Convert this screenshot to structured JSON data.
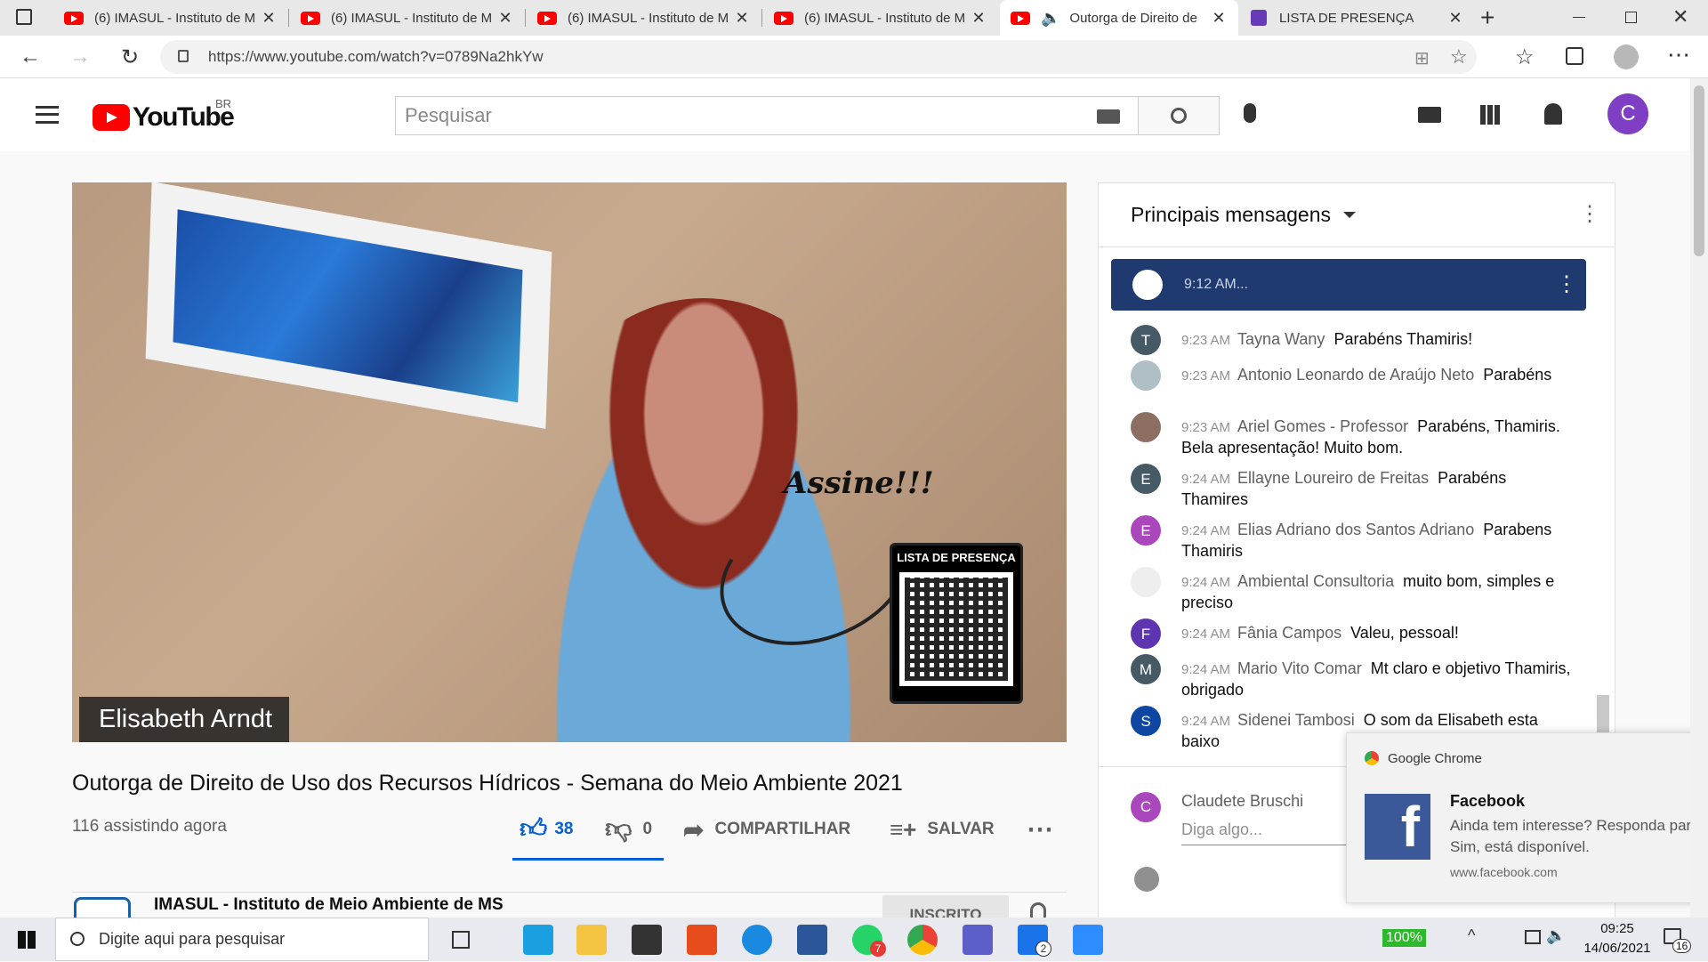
{
  "browser": {
    "tabs": [
      {
        "title": "(6) IMASUL - Instituto de M"
      },
      {
        "title": "(6) IMASUL - Instituto de M"
      },
      {
        "title": "(6) IMASUL - Instituto de M"
      },
      {
        "title": "(6) IMASUL - Instituto de M"
      },
      {
        "title": "Outorga de Direito de"
      },
      {
        "title": "LISTA DE PRESENÇA"
      }
    ],
    "url": "https://www.youtube.com/watch?v=0789Na2hkYw"
  },
  "youtube": {
    "logo": "YouTube",
    "region": "BR",
    "search_placeholder": "Pesquisar",
    "avatar_letter": "C"
  },
  "video": {
    "speaker_name": "Elisabeth Arndt",
    "overlay_text": "Assine!!!",
    "qr_label": "LISTA DE PRESENÇA",
    "title": "Outorga de Direito de Uso dos Recursos Hídricos - Semana do Meio Ambiente 2021",
    "viewers": "116 assistindo agora",
    "likes": "38",
    "dislikes": "0",
    "share_label": "COMPARTILHAR",
    "save_label": "SALVAR",
    "channel_name": "IMASUL - Instituto de Meio Ambiente de MS",
    "subscribe_label": "INSCRITO"
  },
  "chat": {
    "header": "Principais mensagens",
    "pinned_time": "9:12 AM...",
    "messages": [
      {
        "avatar": "T",
        "color": "#455a64",
        "time": "9:23 AM",
        "author": "Tayna Wany",
        "text": "Parabéns Thamiris!"
      },
      {
        "avatar": "",
        "color": "#b0bec5",
        "time": "9:23 AM",
        "author": "Antonio Leonardo de Araújo Neto",
        "text": "Parabéns"
      },
      {
        "avatar": "",
        "color": "#8d6e63",
        "time": "9:23 AM",
        "author": "Ariel Gomes - Professor",
        "text": "Parabéns, Thamiris. Bela apresentação! Muito bom."
      },
      {
        "avatar": "E",
        "color": "#455a64",
        "time": "9:24 AM",
        "author": "Ellayne Loureiro de Freitas",
        "text": "Parabéns Thamires"
      },
      {
        "avatar": "E",
        "color": "#ab47bc",
        "time": "9:24 AM",
        "author": "Elias Adriano dos Santos Adriano",
        "text": "Parabens Thamiris"
      },
      {
        "avatar": "",
        "color": "#eeeeee",
        "time": "9:24 AM",
        "author": "Ambiental Consultoria",
        "text": "muito bom, simples e preciso"
      },
      {
        "avatar": "F",
        "color": "#5e35b1",
        "time": "9:24 AM",
        "author": "Fânia Campos",
        "text": "Valeu, pessoal!"
      },
      {
        "avatar": "M",
        "color": "#455a64",
        "time": "9:24 AM",
        "author": "Mario Vito Comar",
        "text": "Mt claro e objetivo Thamiris, obrigado"
      },
      {
        "avatar": "S",
        "color": "#0d47a1",
        "time": "9:24 AM",
        "author": "Sidenei Tambosi",
        "text": "O som da Elisabeth esta baixo"
      }
    ],
    "input_author": "Claudete Bruschi",
    "input_avatar": "C",
    "input_placeholder": "Diga algo..."
  },
  "toast": {
    "app": "Google Chrome",
    "title": "Facebook",
    "text": "Ainda tem interesse? Responda par Sim, está disponível.",
    "source": "www.facebook.com"
  },
  "taskbar": {
    "search_placeholder": "Digite aqui para pesquisar",
    "battery": "100%",
    "time": "09:25",
    "date": "14/06/2021",
    "notif_count": "16",
    "whatsapp_badge": "7",
    "mail_badge": "2"
  }
}
